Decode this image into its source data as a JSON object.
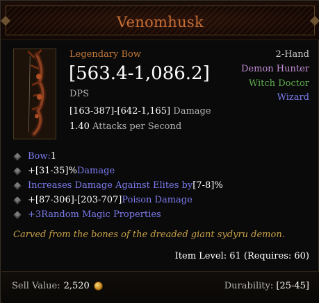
{
  "item": {
    "name": "Venomhusk",
    "type": "Legendary Bow",
    "hand": "2-Hand",
    "classes": [
      "Demon Hunter",
      "Witch Doctor",
      "Wizard"
    ],
    "dps_value": "[563.4-1,086.2]",
    "dps_label": "DPS",
    "damage_value": "[163-387]-[642-1,165]",
    "damage_label": "Damage",
    "aps_value": "1.40",
    "aps_label": "Attacks per Second"
  },
  "affixes": [
    {
      "parts": [
        "Bow: ",
        "1"
      ]
    },
    {
      "parts": [
        "+[31-35]%",
        " Damage"
      ]
    },
    {
      "parts": [
        "Increases Damage Against Elites by ",
        "[7-8]%"
      ]
    },
    {
      "parts": [
        "+[87-306]-[203-707]",
        " Poison Damage"
      ]
    },
    {
      "parts": [
        "+3",
        " Random Magic Properties"
      ]
    }
  ],
  "flavor": "Carved from the bones of the dreaded giant sydyru demon.",
  "item_level": "Item Level: 61 (Requires: 60)",
  "footer": {
    "sell_label": "Sell Value:",
    "sell_value": "2,520",
    "durability_label": "Durability:",
    "durability_value": "[25-45]"
  },
  "colors": {
    "legendary": "#c86f36",
    "magic": "#7c7cf0",
    "demon_hunter": "#c58fd8",
    "witch_doctor": "#5fae4e",
    "wizard": "#7c7cf0",
    "flavor": "#c9a24a"
  },
  "icons": {
    "item_icon": "bow-icon",
    "bullet_icon": "diamond-bullet-icon",
    "currency_icon": "gold-coin-icon"
  }
}
